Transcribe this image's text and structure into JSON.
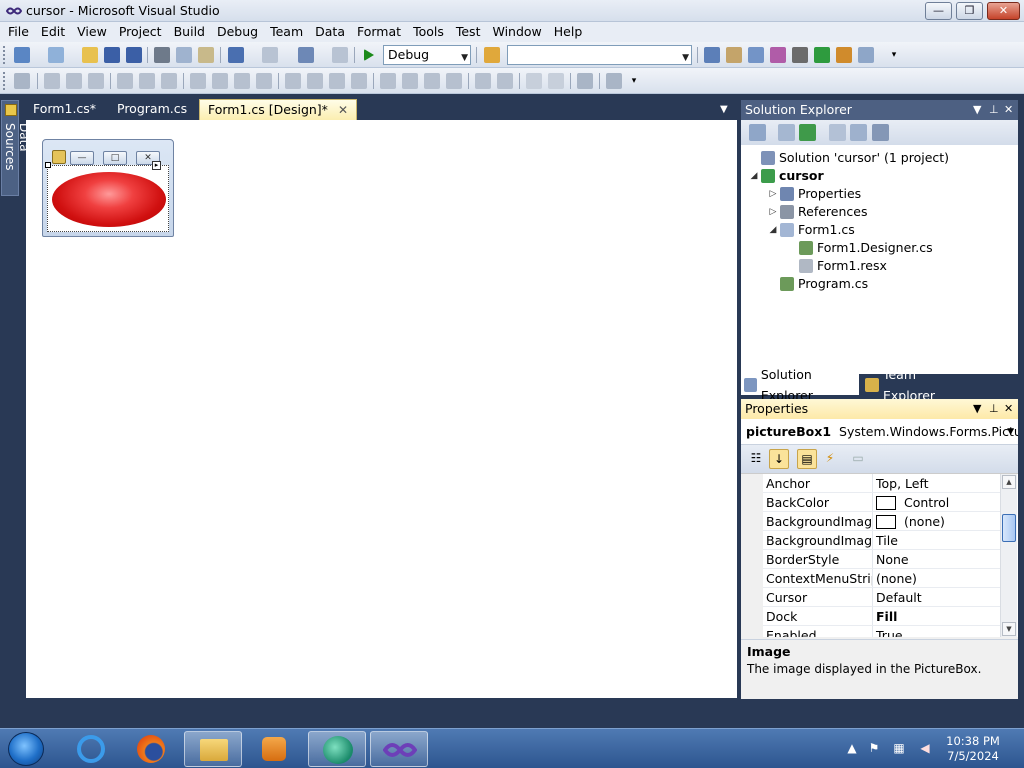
{
  "window": {
    "title": "cursor - Microsoft Visual Studio",
    "controls": {
      "minimize": "—",
      "maximize": "❒",
      "close": "✕"
    }
  },
  "menu": [
    "File",
    "Edit",
    "View",
    "Project",
    "Build",
    "Debug",
    "Team",
    "Data",
    "Format",
    "Tools",
    "Test",
    "Window",
    "Help"
  ],
  "toolbar": {
    "config_combo": "Debug",
    "platform_combo": ""
  },
  "left_strip": {
    "data_sources": "Data Sources"
  },
  "document_tabs": [
    {
      "label": "Form1.cs*",
      "active": false
    },
    {
      "label": "Program.cs",
      "active": false
    },
    {
      "label": "Form1.cs [Design]*",
      "active": true
    }
  ],
  "designer": {
    "form_controls": {
      "minimize": "—",
      "maximize": "□",
      "close": "✕"
    },
    "smart_tag": "▸"
  },
  "solution_explorer": {
    "title": "Solution Explorer",
    "tree": [
      {
        "label": "Solution 'cursor' (1 project)",
        "level": 0,
        "arrow": "",
        "bold": false,
        "icon": "solution-icon"
      },
      {
        "label": "cursor",
        "level": 0,
        "arrow": "◢",
        "bold": true,
        "icon": "project-icon"
      },
      {
        "label": "Properties",
        "level": 1,
        "arrow": "▷",
        "bold": false,
        "icon": "properties-folder-icon"
      },
      {
        "label": "References",
        "level": 1,
        "arrow": "▷",
        "bold": false,
        "icon": "references-folder-icon"
      },
      {
        "label": "Form1.cs",
        "level": 1,
        "arrow": "◢",
        "bold": false,
        "icon": "form-file-icon"
      },
      {
        "label": "Form1.Designer.cs",
        "level": 2,
        "arrow": "",
        "bold": false,
        "icon": "cs-file-icon"
      },
      {
        "label": "Form1.resx",
        "level": 2,
        "arrow": "",
        "bold": false,
        "icon": "resx-file-icon"
      },
      {
        "label": "Program.cs",
        "level": 1,
        "arrow": "",
        "bold": false,
        "icon": "cs-file-icon"
      }
    ],
    "tabs": [
      "Solution Explorer",
      "Team Explorer"
    ]
  },
  "properties": {
    "title": "Properties",
    "selected_object_name": "pictureBox1",
    "selected_object_type": "System.Windows.Forms.PictureBo",
    "rows": [
      {
        "name": "Anchor",
        "value": "Top, Left",
        "swatch": false,
        "bold": false
      },
      {
        "name": "BackColor",
        "value": "Control",
        "swatch": true,
        "bold": false
      },
      {
        "name": "BackgroundImage",
        "value": "(none)",
        "swatch": true,
        "bold": false
      },
      {
        "name": "BackgroundImageLa",
        "value": "Tile",
        "swatch": false,
        "bold": false
      },
      {
        "name": "BorderStyle",
        "value": "None",
        "swatch": false,
        "bold": false
      },
      {
        "name": "ContextMenuStrip",
        "value": "(none)",
        "swatch": false,
        "bold": false
      },
      {
        "name": "Cursor",
        "value": "Default",
        "swatch": false,
        "bold": false
      },
      {
        "name": "Dock",
        "value": "Fill",
        "swatch": false,
        "bold": true
      },
      {
        "name": "Enabled",
        "value": "True",
        "swatch": false,
        "bold": false
      }
    ],
    "description_title": "Image",
    "description_text": "The image displayed in the PictureBox."
  },
  "taskbar": {
    "apps": [
      "internet-explorer-icon",
      "firefox-icon",
      "file-explorer-icon",
      "media-player-icon",
      "camtasia-icon",
      "visual-studio-icon"
    ],
    "clock_time": "10:38 PM",
    "clock_date": "7/5/2024"
  },
  "colors": {
    "chrome_dark": "#293955",
    "active_tab": "#fbeeb0",
    "ellipse_red": "#d01010"
  }
}
